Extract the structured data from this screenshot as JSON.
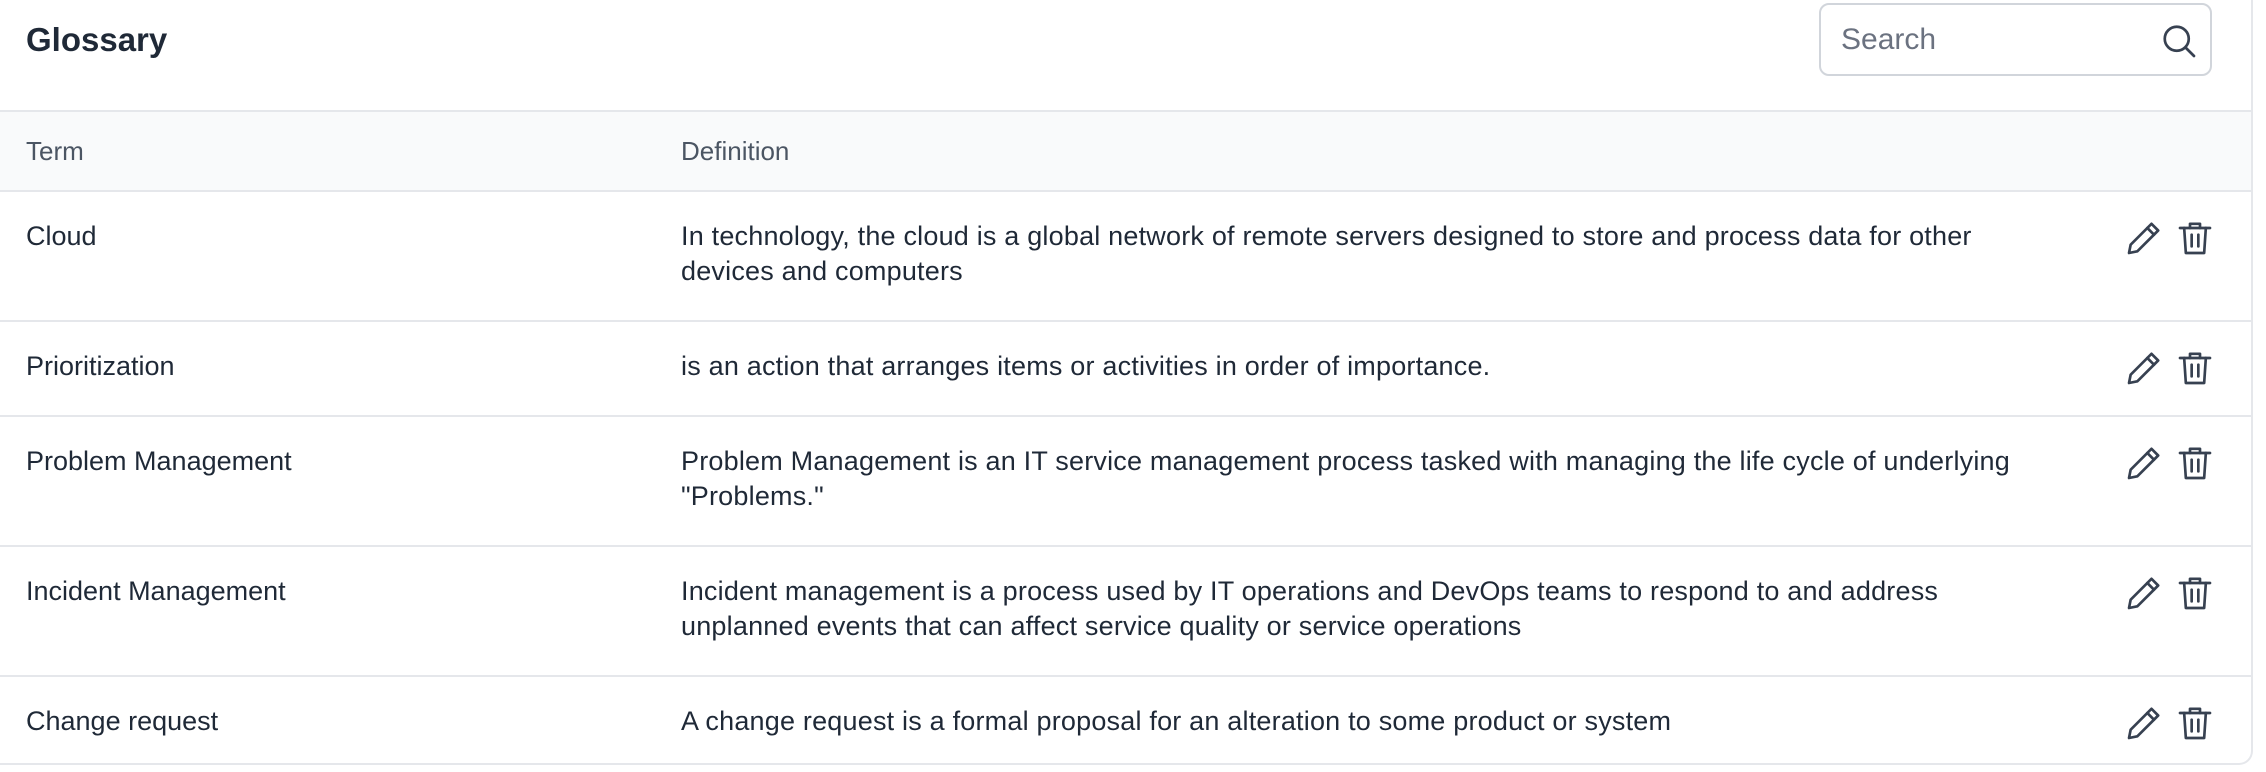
{
  "header": {
    "title": "Glossary",
    "search_placeholder": "Search",
    "search_value": ""
  },
  "table": {
    "columns": [
      "Term",
      "Definition"
    ],
    "rows": [
      {
        "term": "Cloud",
        "definition": "In technology, the cloud is a global network of remote servers designed to store and process data for other devices and computers"
      },
      {
        "term": "Prioritization",
        "definition": "is an action that arranges items or activities in order of importance."
      },
      {
        "term": "Problem Management",
        "definition": "Problem Management is an IT service management process tasked with managing the life cycle of underlying \"Problems.\""
      },
      {
        "term": "Incident Management",
        "definition": "Incident management is a process used by IT operations and DevOps teams to respond to and address unplanned events that can affect service quality or service operations"
      },
      {
        "term": "Change request",
        "definition": "A change request is a formal proposal for an alteration to some product or system"
      }
    ],
    "row_actions": [
      "pencil-icon",
      "trash-icon"
    ]
  },
  "colors": {
    "border": "#e5e7eb",
    "header_bg": "#f9fafb",
    "text": "#1f2937",
    "muted_text": "#4b5563",
    "icon": "#374151"
  }
}
